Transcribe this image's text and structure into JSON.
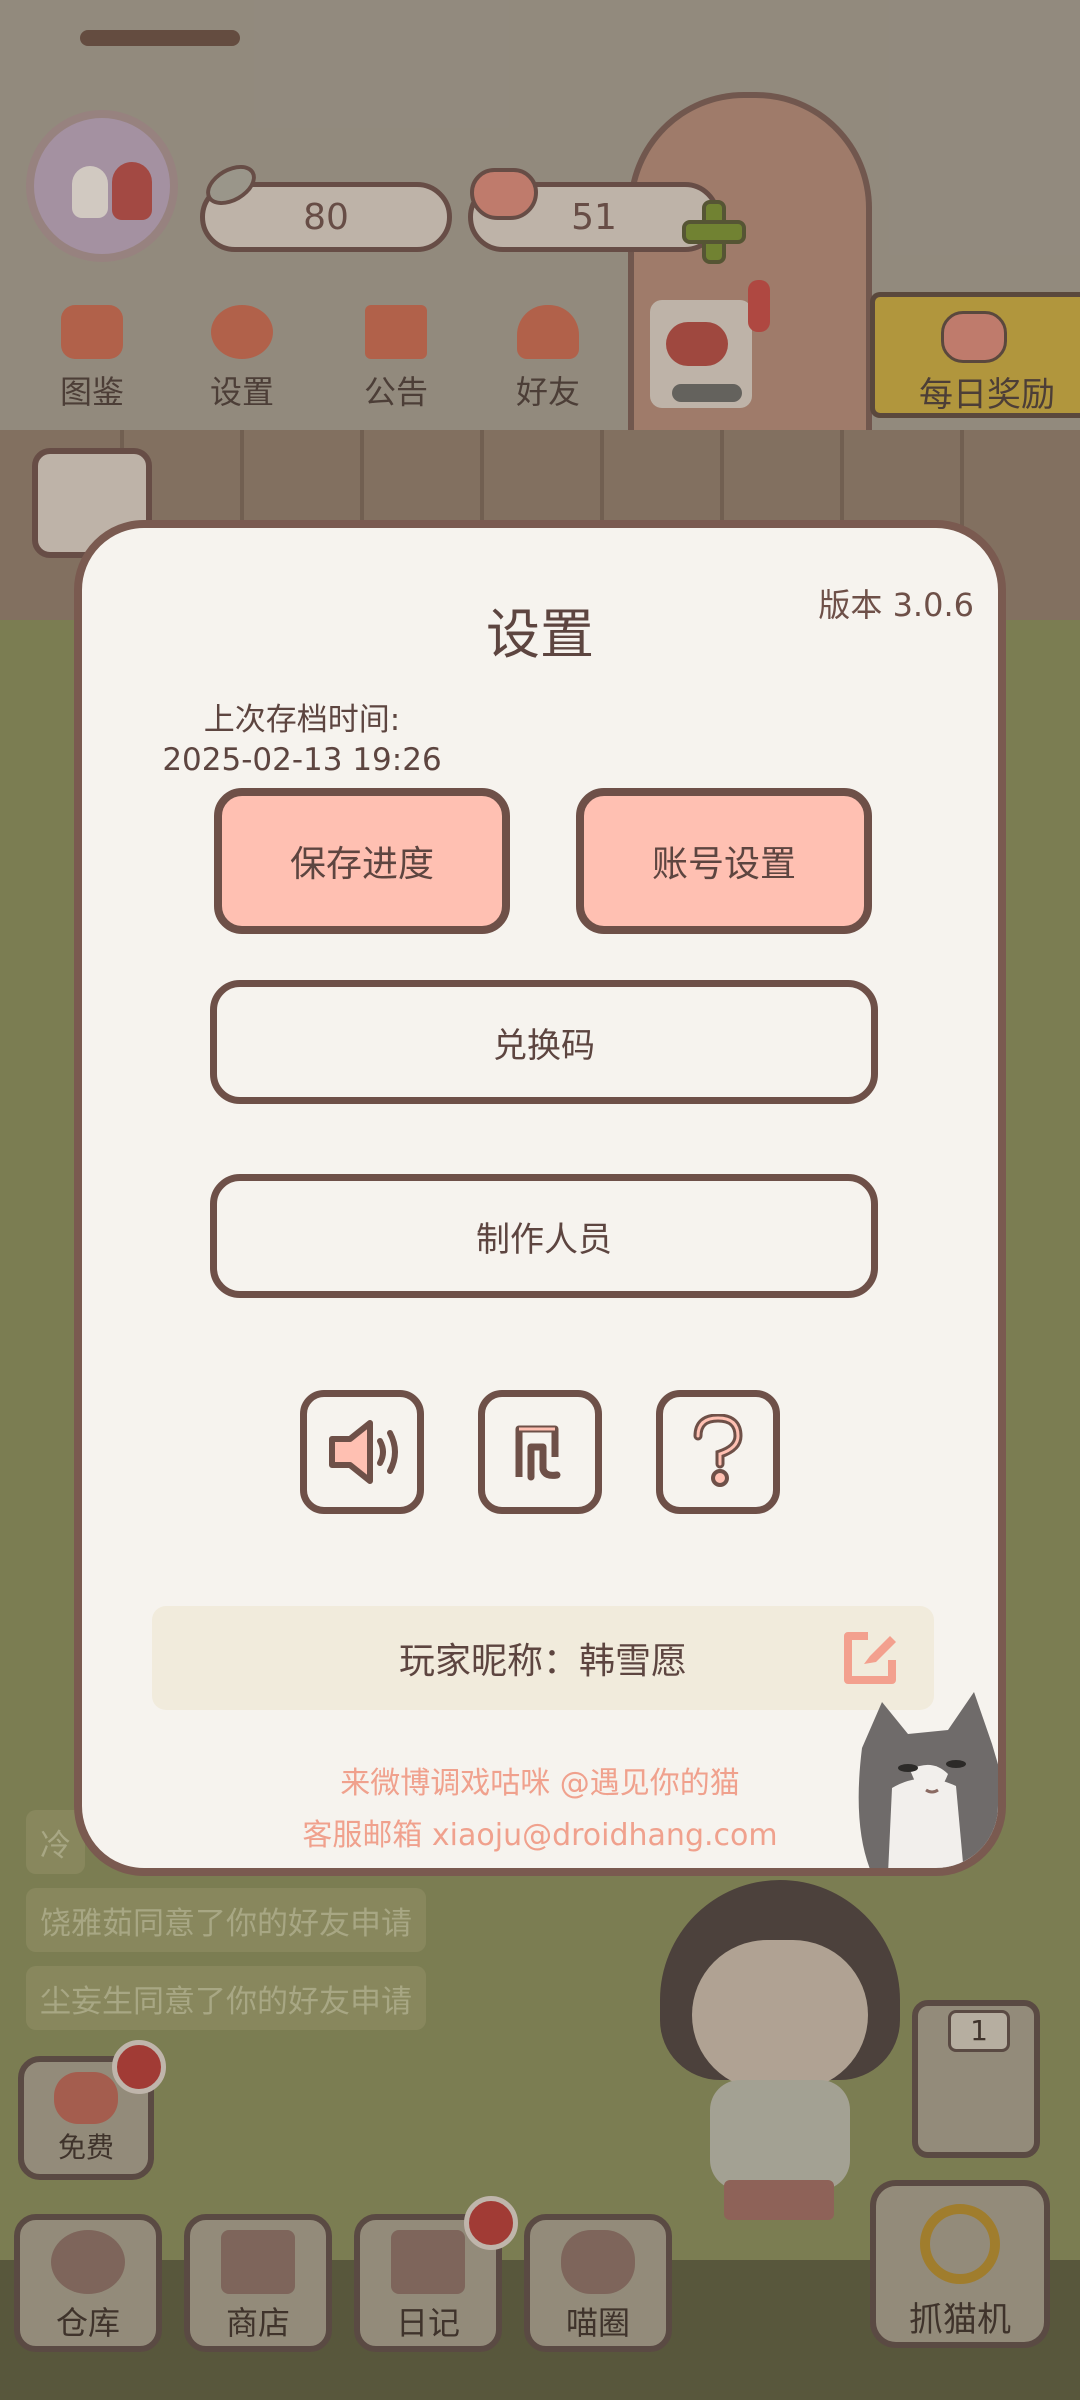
{
  "hud": {
    "fish_count": "80",
    "heart_count": "51",
    "buttons": [
      {
        "label": "图鉴",
        "icon": "cat-book-icon"
      },
      {
        "label": "设置",
        "icon": "gear-icon"
      },
      {
        "label": "公告",
        "icon": "gift-icon"
      },
      {
        "label": "好友",
        "icon": "friends-icon"
      }
    ],
    "daily_reward": "每日奖励"
  },
  "modal": {
    "title": "设置",
    "version": "版本 3.0.6",
    "save_time_label": "上次存档时间:",
    "save_time_value": "2025-02-13 19:26",
    "save_button": "保存进度",
    "account_button": "账号设置",
    "redeem_button": "兑换码",
    "credits_button": "制作人员",
    "icon_buttons": [
      "speaker-icon",
      "music-icon",
      "help-icon"
    ],
    "nickname": "玩家昵称：韩雪愿",
    "weibo_line": "来微博调戏咕咪 @遇见你的猫",
    "email_line": "客服邮箱 xiaoju@droidhang.com"
  },
  "notifications": [
    "冷",
    "饶雅茹同意了你的好友申请",
    "尘妄生同意了你的好友申请"
  ],
  "bottom": {
    "free_label": "免费",
    "items": [
      "仓库",
      "商店",
      "日记",
      "喵圈"
    ],
    "claw_label": "抓猫机",
    "elevator_floor": "1"
  },
  "colors": {
    "modal_bg": "#f6f3ee",
    "border": "#6e5048",
    "pink_button": "#ffc0b2",
    "link_text": "#f0a18d"
  }
}
